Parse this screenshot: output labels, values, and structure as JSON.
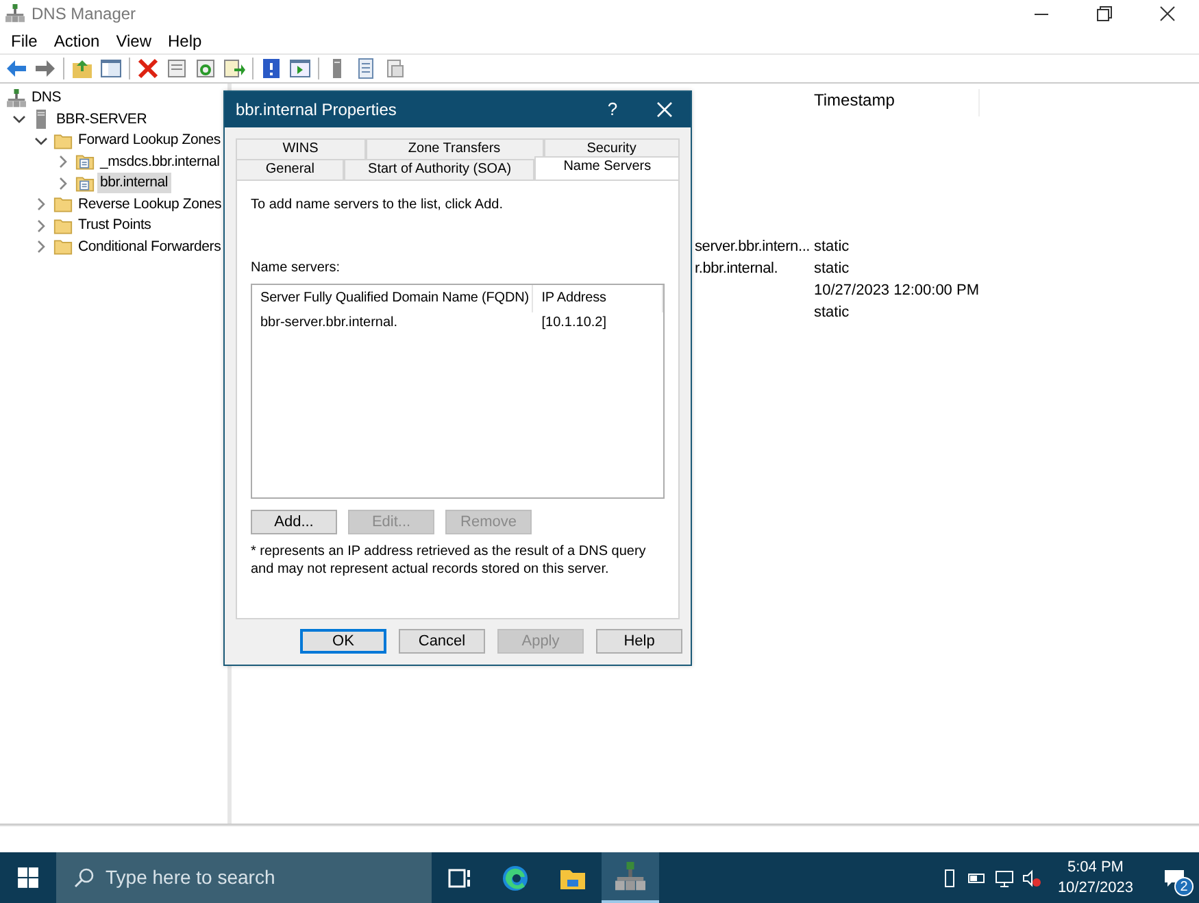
{
  "window": {
    "title": "DNS Manager"
  },
  "menu": [
    "File",
    "Action",
    "View",
    "Help"
  ],
  "tree": [
    {
      "label": "DNS",
      "kind": "dns",
      "selected": false,
      "children": [
        {
          "label": "BBR-SERVER",
          "kind": "server",
          "expanded": true,
          "selected": false,
          "children": [
            {
              "label": "Forward Lookup Zones",
              "kind": "folder",
              "expanded": true,
              "selected": false,
              "children": [
                {
                  "label": "_msdcs.bbr.internal",
                  "kind": "zone",
                  "expanded": false,
                  "selected": false
                },
                {
                  "label": "bbr.internal",
                  "kind": "zone",
                  "expanded": false,
                  "selected": true
                }
              ]
            },
            {
              "label": "Reverse Lookup Zones",
              "kind": "folder",
              "expanded": false,
              "selected": false
            },
            {
              "label": "Trust Points",
              "kind": "folder",
              "expanded": false,
              "selected": false
            },
            {
              "label": "Conditional Forwarders",
              "kind": "folder",
              "expanded": false,
              "selected": false
            }
          ]
        }
      ]
    }
  ],
  "list": {
    "columns": [
      "Timestamp"
    ],
    "rows": [
      {
        "column_1": "server.bbr.intern...",
        "timestamp": "static"
      },
      {
        "column_1": "r.bbr.internal.",
        "timestamp": "static"
      },
      {
        "column_1": "",
        "timestamp": "10/27/2023 12:00:00 PM"
      },
      {
        "column_1": "",
        "timestamp": "static"
      }
    ]
  },
  "dialog": {
    "title": "bbr.internal Properties",
    "help_button": "?",
    "tab_rows": [
      [
        {
          "label": "WINS",
          "selected": false
        },
        {
          "label": "Zone Transfers",
          "selected": false
        },
        {
          "label": "Security",
          "selected": false
        }
      ],
      [
        {
          "label": "General",
          "selected": false
        },
        {
          "label": "Start of Authority (SOA)",
          "selected": false
        },
        {
          "label": "Name Servers",
          "selected": true
        }
      ]
    ],
    "instruction": "To add name servers to the list, click Add.",
    "servers_label": "Name servers:",
    "servers_table": {
      "columns": [
        "Server Fully Qualified Domain Name (FQDN)",
        "IP Address"
      ],
      "rows": [
        [
          "bbr-server.bbr.internal.",
          "[10.1.10.2]"
        ]
      ]
    },
    "list_buttons": [
      {
        "label": "Add...",
        "disabled": false
      },
      {
        "label": "Edit...",
        "disabled": true
      },
      {
        "label": "Remove",
        "disabled": true
      }
    ],
    "note": "* represents an IP address retrieved as the result of a DNS query and may not represent actual records stored on this server.",
    "buttons": [
      {
        "label": "OK",
        "disabled": false,
        "default": true
      },
      {
        "label": "Cancel",
        "disabled": false,
        "default": false
      },
      {
        "label": "Apply",
        "disabled": true,
        "default": false
      },
      {
        "label": "Help",
        "disabled": false,
        "default": false
      }
    ]
  },
  "taskbar": {
    "search_placeholder": "Type here to search",
    "time": "5:04 PM",
    "date": "10/27/2023",
    "notification_count": "2"
  }
}
